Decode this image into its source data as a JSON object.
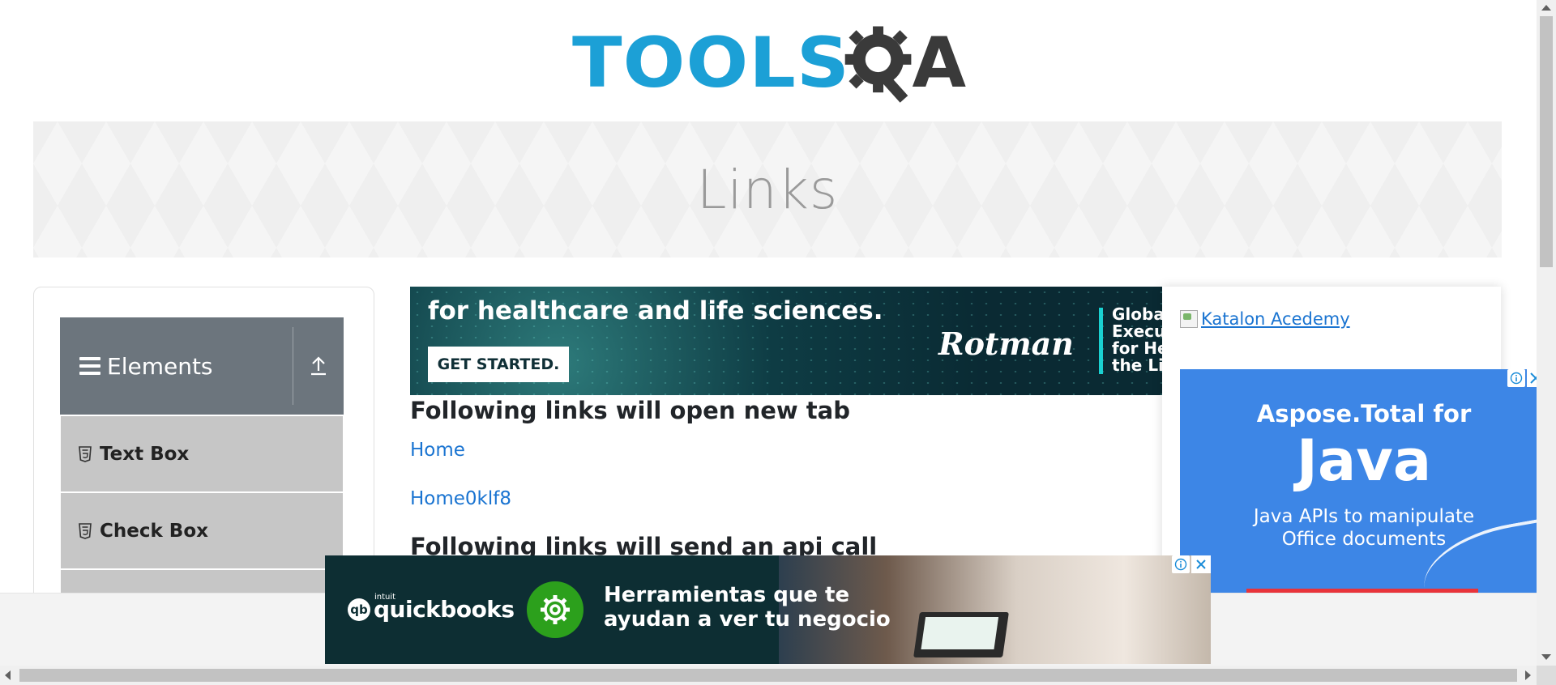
{
  "header": {
    "logo_text_tools": "TOOLS",
    "logo_text_a": "A",
    "logo_color": "#1ca0d6"
  },
  "banner": {
    "title": "Links"
  },
  "sidebar": {
    "group": {
      "label": "Elements"
    },
    "items": [
      {
        "label": "Text Box",
        "icon": "html5-icon"
      },
      {
        "label": "Check Box",
        "icon": "html5-icon"
      }
    ]
  },
  "ads": {
    "top": {
      "headline": "for healthcare and life sciences.",
      "cta": "GET STARTED.",
      "brand": "Rotman",
      "side_text": "Globa\nExecu\nfor He\nthe Lif"
    },
    "right_image_alt": "Katalon Acedemy",
    "right": {
      "line1": "Aspose.Total for",
      "line2": "Java",
      "line3": "Java APIs to manipulate\nOffice documents"
    },
    "bottom": {
      "brand_small": "intuit",
      "brand": "quickbooks",
      "message": "Herramientas que te\nayudan a ver tu negocio"
    }
  },
  "content": {
    "heading_new_tab": "Following links will open new tab",
    "links_new_tab": [
      "Home",
      "Home0klf8"
    ],
    "heading_api": "Following links will send an api call"
  }
}
